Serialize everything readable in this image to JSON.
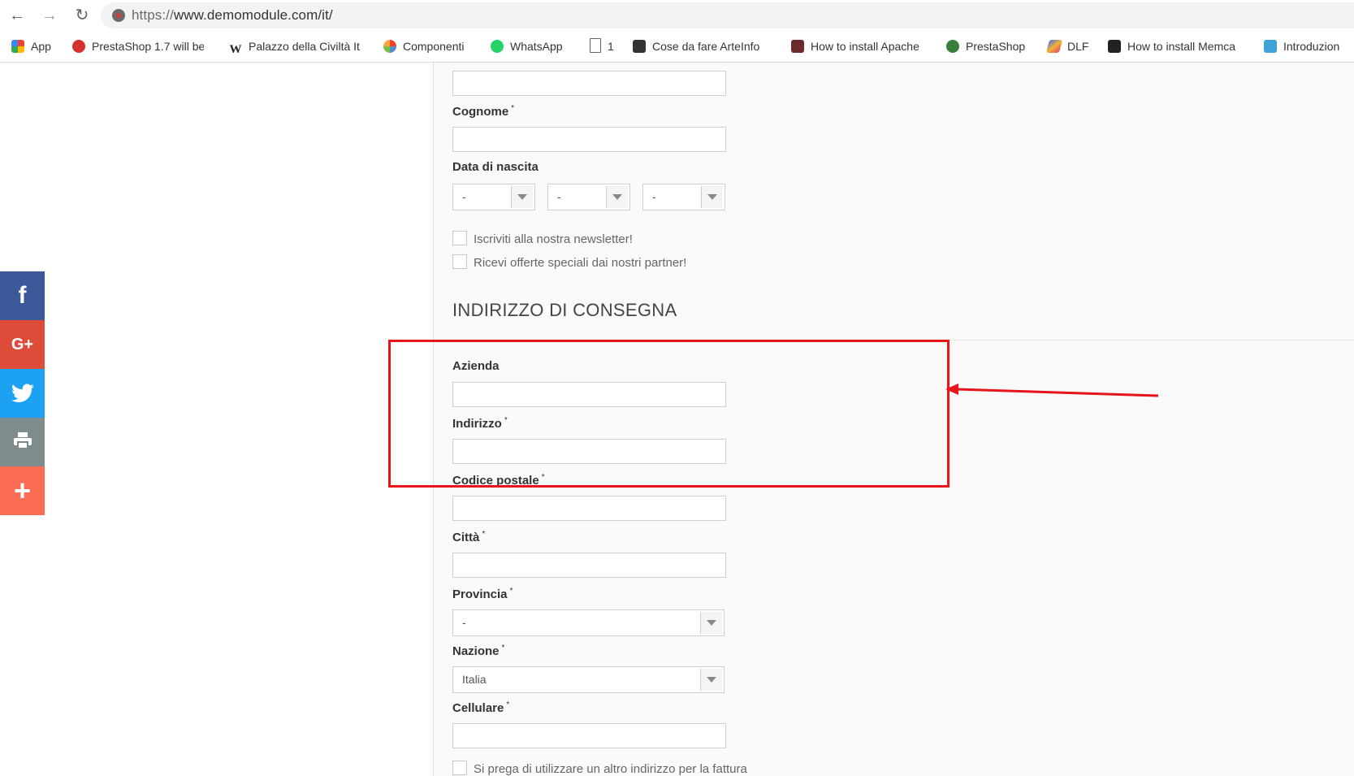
{
  "browser": {
    "url_scheme": "https://",
    "url_rest": "www.demomodule.com/it/",
    "nav": {
      "back": "←",
      "forward": "→",
      "reload": "↻"
    }
  },
  "bookmarks": [
    {
      "label": "App",
      "icon": "apps-grid-icon",
      "color": "#4285f4"
    },
    {
      "label": "PrestaShop 1.7 will be",
      "icon": "prestashop-swirl-icon",
      "color": "#d6322c"
    },
    {
      "label": "Palazzo della Civiltà It",
      "icon": "wikipedia-icon",
      "color": "#222222"
    },
    {
      "label": "Componenti",
      "icon": "joomla-icon",
      "color": "#f44321"
    },
    {
      "label": "WhatsApp",
      "icon": "whatsapp-icon",
      "color": "#25d366"
    },
    {
      "label": "1",
      "icon": "page-icon",
      "color": "#5f6368"
    },
    {
      "label": "Cose da fare ArteInfo",
      "icon": "trello-icon",
      "color": "#333333"
    },
    {
      "label": "How to install Apache",
      "icon": "vps-icon",
      "color": "#222222"
    },
    {
      "label": "PrestaShop",
      "icon": "prestashop-icon",
      "color": "#3b7d3b"
    },
    {
      "label": "DLF",
      "icon": "dlf-icon",
      "color": "#3c6df0"
    },
    {
      "label": "How to install Memca",
      "icon": "cloud-icon",
      "color": "#222222"
    },
    {
      "label": "Introduzion",
      "icon": "chat-icon",
      "color": "#3fa3d9"
    }
  ],
  "social": [
    {
      "name": "facebook",
      "glyph": "f",
      "color": "#3b5998"
    },
    {
      "name": "google-plus",
      "glyph": "G+",
      "color": "#dd4b39"
    },
    {
      "name": "twitter",
      "glyph": "🐦",
      "color": "#1da1f2"
    },
    {
      "name": "print",
      "glyph": "🖶",
      "color": "#7f8c8d"
    },
    {
      "name": "more",
      "glyph": "+",
      "color": "#fa6d54"
    }
  ],
  "form": {
    "cognome_label": "Cognome",
    "birthdate_label": "Data di nascita",
    "birth_day": "-",
    "birth_month": "-",
    "birth_year": "-",
    "newsletter_label": "Iscriviti alla nostra newsletter!",
    "partner_label": "Ricevi offerte speciali dai nostri partner!",
    "required_mark": "*"
  },
  "delivery": {
    "section_title": "INDIRIZZO DI CONSEGNA",
    "azienda_label": "Azienda",
    "indirizzo_label": "Indirizzo",
    "cap_label": "Codice postale",
    "citta_label": "Città",
    "provincia_label": "Provincia",
    "provincia_value": "-",
    "nazione_label": "Nazione",
    "nazione_value": "Italia",
    "cellulare_label": "Cellulare",
    "alt_address_label": "Si prega di utilizzare un altro indirizzo per la fattura"
  },
  "annotation": {
    "color": "#e8141c"
  }
}
